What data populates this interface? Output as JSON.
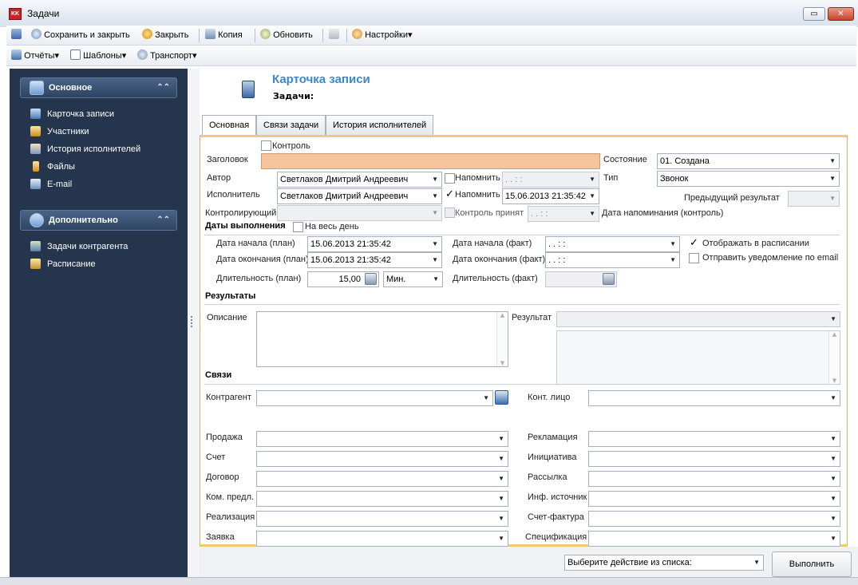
{
  "window": {
    "icon_text": "KK",
    "title": "Задачи",
    "restore": "▭",
    "close": "✕"
  },
  "toolbar1": [
    {
      "label": "",
      "icon": "save-icon"
    },
    {
      "label": "Сохранить и закрыть",
      "icon": "save-close-icon"
    },
    {
      "label": "Закрыть",
      "icon": "close-doc-icon"
    },
    {
      "label": "Копия",
      "icon": "copy-icon"
    },
    {
      "label": "Обновить",
      "icon": "refresh-icon"
    },
    {
      "label": "",
      "icon": "up-icon"
    },
    {
      "label": "Настройки▾",
      "icon": "settings-icon"
    }
  ],
  "toolbar2": [
    {
      "label": "Отчёты▾",
      "icon": "reports-icon"
    },
    {
      "label": "Шаблоны▾",
      "icon": "templates-icon"
    },
    {
      "label": "Транспорт▾",
      "icon": "transport-icon"
    }
  ],
  "sidebar": {
    "main_header": "Основное",
    "main_items": [
      "Карточка записи",
      "Участники",
      "История исполнителей",
      "Файлы",
      "E-mail"
    ],
    "extra_header": "Дополнительно",
    "extra_items": [
      "Задачи контрагента",
      "Расписание"
    ],
    "collapse": "⌃⌃"
  },
  "card": {
    "title": "Карточка записи",
    "subtitle": "Задачи:"
  },
  "tabs": [
    "Основная",
    "Связи задачи",
    "История исполнителей"
  ],
  "form": {
    "control_label": "Контроль",
    "title_label": "Заголовок",
    "title_value": "",
    "state_label": "Состояние",
    "state_value": "01. Создана",
    "author_label": "Автор",
    "author_value": "Светлаков Дмитрий Андреевич",
    "remind1_label": "Напомнить",
    "remind1_value": " .  .   : :",
    "type_label": "Тип",
    "type_value": "Звонок",
    "executor_label": "Исполнитель",
    "executor_value": "Светлаков Дмитрий Андреевич",
    "remind2_label": "Напомнить",
    "remind2_value": "15.06.2013 21:35:42",
    "prev_result_label": "Предыдущий результат",
    "prev_result_value": "",
    "controller_label": "Контролирующий",
    "controller_value": "",
    "control_accepted_label": "Контроль принят",
    "control_accepted_value": " .  .   : :",
    "remind_date_control_label": "Дата напоминания (контроль)",
    "dates_section": "Даты выполнения",
    "all_day_label": "На весь день",
    "start_plan_label": "Дата начала (план)",
    "start_plan_value": "15.06.2013 21:35:42",
    "start_fact_label": "Дата начала (факт)",
    "start_fact_value": " .  .   : :",
    "show_schedule_label": "Отображать в расписании",
    "end_plan_label": "Дата окончания (план)",
    "end_plan_value": "15.06.2013 21:35:42",
    "end_fact_label": "Дата окончания (факт)",
    "end_fact_value": " .  .   : :",
    "send_email_label": "Отправить уведомление по email",
    "duration_plan_label": "Длительность (план)",
    "duration_plan_value": "15,00",
    "duration_unit_value": "Мин.",
    "duration_fact_label": "Длительность (факт)",
    "duration_fact_value": "",
    "results_section": "Результаты",
    "description_label": "Описание",
    "result_label": "Результат",
    "result_value": "",
    "links_section": "Связи",
    "counterparty_label": "Контрагент",
    "contact_label": "Конт. лицо",
    "left_links": [
      "Продажа",
      "Счет",
      "Договор",
      "Ком. предл.",
      "Реализация",
      "Заявка"
    ],
    "right_links": [
      "Рекламация",
      "Инициатива",
      "Рассылка",
      "Инф. источник",
      "Счет-фактура",
      "Спецификация"
    ]
  },
  "bottom": {
    "action_value": "Выберите действие из списка:",
    "run_label": "Выполнить"
  },
  "colors": {
    "sidebar": "#25354d",
    "accent_title": "#3b86d2",
    "title_field": "#f5c49c",
    "tab_panel_border": "#f3c974"
  }
}
